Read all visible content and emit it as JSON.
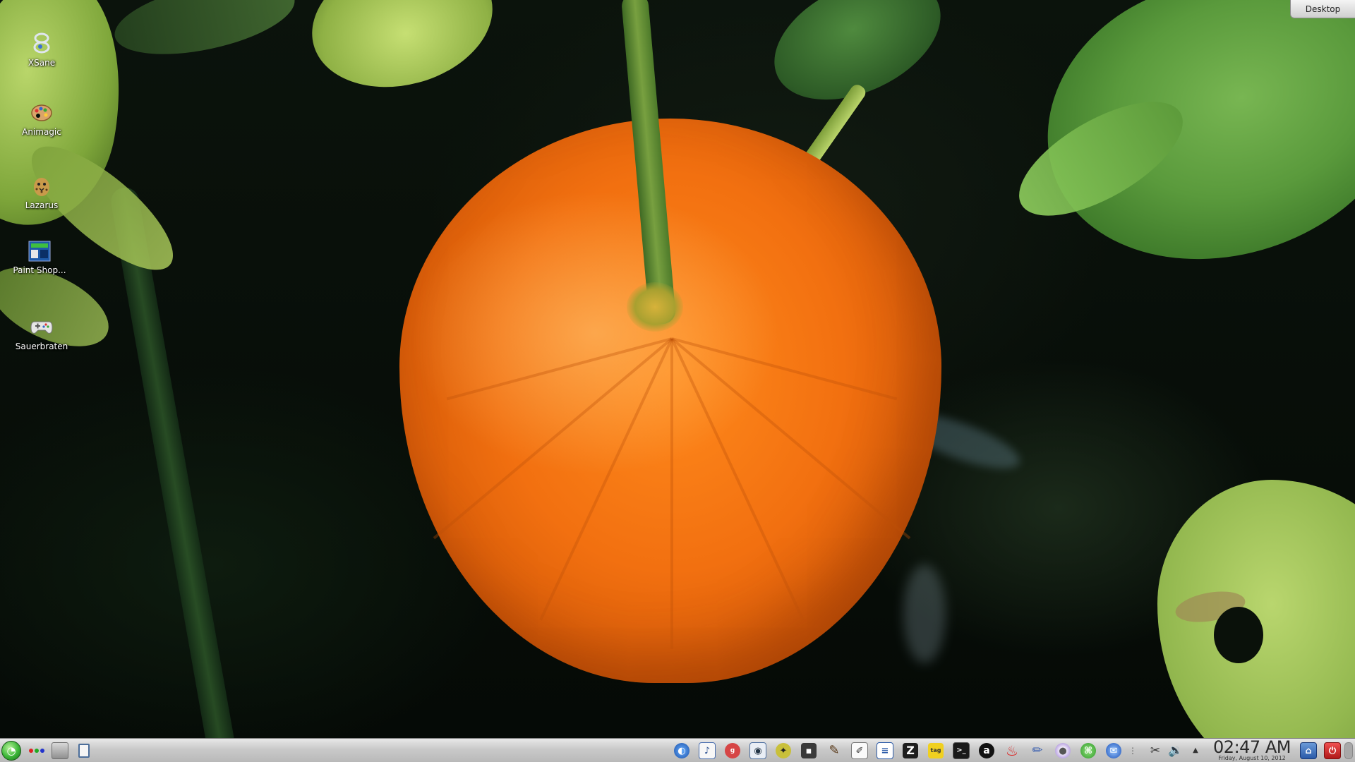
{
  "desktop": {
    "button_label": "Desktop",
    "icons": [
      {
        "label": "XSane",
        "icon": "scanner-icon"
      },
      {
        "label": "Animagic",
        "icon": "palette-icon"
      },
      {
        "label": "Lazarus",
        "icon": "cheetah-icon"
      },
      {
        "label": "Paint Shop...",
        "icon": "paint-shop-icon"
      },
      {
        "label": "Sauerbraten",
        "icon": "gamepad-icon"
      }
    ]
  },
  "taskbar": {
    "start_icon": "start-orb-icon",
    "tray_icons": [
      "browser-icon",
      "notes-icon",
      "gnip-icon",
      "screenshot-icon",
      "film-icon",
      "save-icon",
      "brush-icon",
      "text-editor-icon",
      "document-icon",
      "zim-icon",
      "easytag-icon",
      "terminal-icon",
      "a-icon",
      "flame-icon",
      "pencil-icon",
      "disc-burner-icon",
      "network-icon",
      "thunderbird-icon",
      "keyboard-icon",
      "scissors-icon",
      "volume-icon",
      "expand-arrow-icon"
    ],
    "clock": {
      "time": "02:47 AM",
      "date": "Friday, August 10, 2012"
    },
    "end_icons": [
      "home-icon",
      "power-icon"
    ]
  }
}
